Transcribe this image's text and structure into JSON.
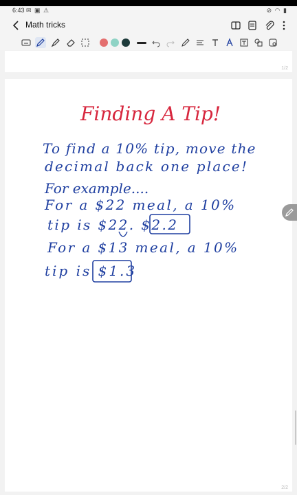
{
  "status": {
    "time": "6:43"
  },
  "header": {
    "title": "Math tricks"
  },
  "colors": {
    "swatch_red": "#e46f6f",
    "swatch_teal": "#8fd3c5",
    "swatch_dark": "#1d3a3a",
    "ink_red": "#d7263d",
    "ink_blue": "#1f3fa0"
  },
  "pages": {
    "page1_num": "1/2",
    "page2_num": "2/2"
  },
  "note": {
    "heading": "Finding A Tip!",
    "lines": [
      "To find a 10% tip, move the",
      "decimal back one place!",
      "For example....",
      "For a $22 meal, a 10%",
      "tip is $22. $2.2",
      "For a $13 meal, a 10%",
      "tip is $1.3"
    ]
  }
}
